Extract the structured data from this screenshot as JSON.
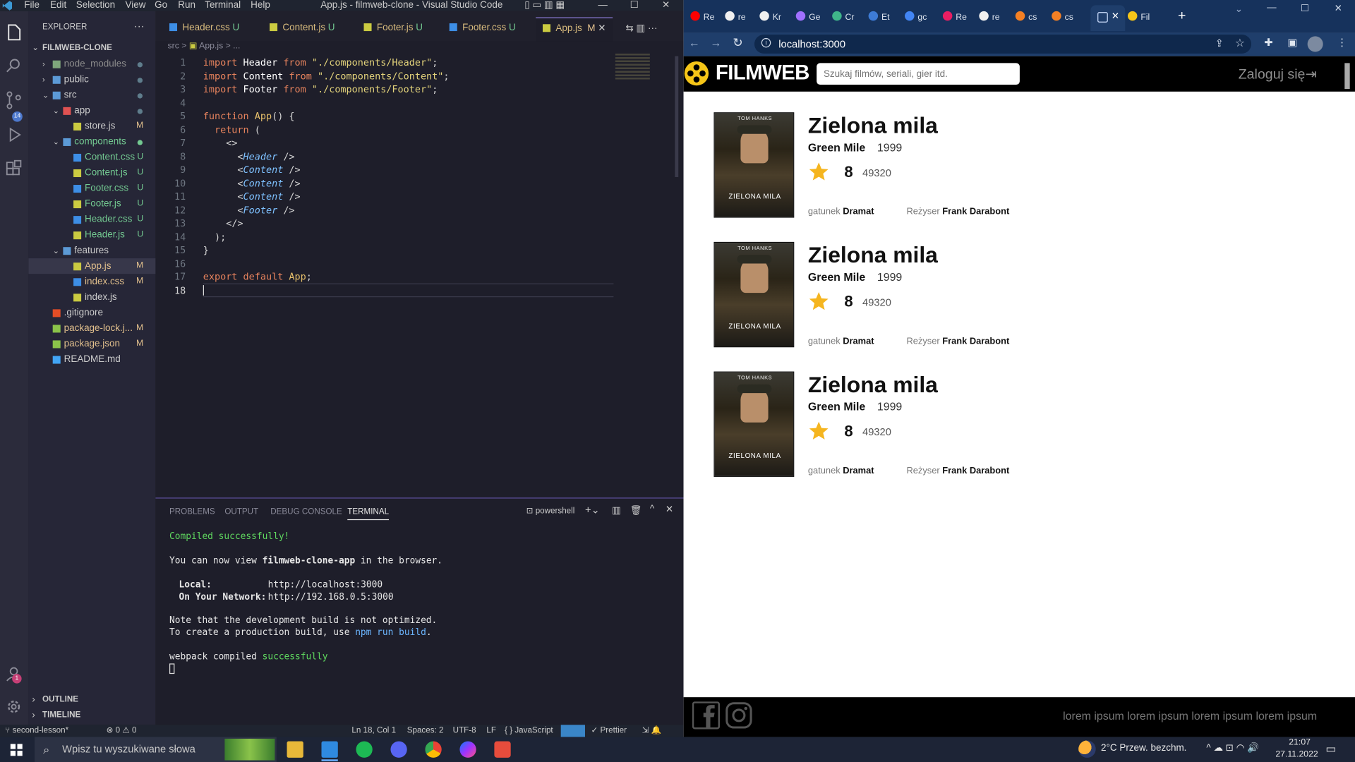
{
  "vscode": {
    "menu": [
      "File",
      "Edit",
      "Selection",
      "View",
      "Go",
      "Run",
      "Terminal",
      "Help"
    ],
    "title": "App.js - filmweb-clone - Visual Studio Code",
    "explorer_label": "EXPLORER",
    "project": "FILMWEB-CLONE",
    "scm_badge": "14",
    "accounts_badge": "1",
    "tree": [
      {
        "label": "node_modules",
        "color": "#8b8b8b",
        "status": "",
        "dot": true
      },
      {
        "label": "public",
        "color": "#cccccc",
        "status": "",
        "dot": true
      },
      {
        "label": "src",
        "color": "#cccccc",
        "status": "",
        "dot": true
      },
      {
        "label": "app",
        "color": "#cccccc",
        "status": "",
        "dot": true
      },
      {
        "label": "store.js",
        "color": "#cccccc",
        "status": "M"
      },
      {
        "label": "components",
        "color": "#73c991",
        "status": "",
        "dot": true
      },
      {
        "label": "Content.css",
        "color": "#73c991",
        "status": "U"
      },
      {
        "label": "Content.js",
        "color": "#73c991",
        "status": "U"
      },
      {
        "label": "Footer.css",
        "color": "#73c991",
        "status": "U"
      },
      {
        "label": "Footer.js",
        "color": "#73c991",
        "status": "U"
      },
      {
        "label": "Header.css",
        "color": "#73c991",
        "status": "U"
      },
      {
        "label": "Header.js",
        "color": "#73c991",
        "status": "U"
      },
      {
        "label": "features",
        "color": "#cccccc",
        "status": ""
      },
      {
        "label": "App.js",
        "color": "#e2c08d",
        "status": "M"
      },
      {
        "label": "index.css",
        "color": "#e2c08d",
        "status": "M"
      },
      {
        "label": "index.js",
        "color": "#cccccc",
        "status": ""
      },
      {
        "label": ".gitignore",
        "color": "#cccccc",
        "status": ""
      },
      {
        "label": "package-lock.j...",
        "color": "#e2c08d",
        "status": "M"
      },
      {
        "label": "package.json",
        "color": "#e2c08d",
        "status": "M"
      },
      {
        "label": "README.md",
        "color": "#cccccc",
        "status": ""
      }
    ],
    "outline": "OUTLINE",
    "timeline": "TIMELINE",
    "tabs": [
      {
        "name": "Header.css",
        "status": "U"
      },
      {
        "name": "Content.js",
        "status": "U"
      },
      {
        "name": "Footer.js",
        "status": "U"
      },
      {
        "name": "Footer.css",
        "status": "U"
      },
      {
        "name": "App.js",
        "status": "M"
      }
    ],
    "breadcrumb": [
      "src",
      ">",
      "App.js",
      ">",
      "..."
    ],
    "line_numbers": [
      "1",
      "2",
      "3",
      "4",
      "5",
      "6",
      "7",
      "8",
      "9",
      "10",
      "11",
      "12",
      "13",
      "14",
      "15",
      "16",
      "17",
      "18"
    ],
    "panel_tabs": [
      "PROBLEMS",
      "OUTPUT",
      "DEBUG CONSOLE",
      "TERMINAL"
    ],
    "shell": "powershell",
    "terminal": {
      "compiled": "Compiled successfully!",
      "view1": "You can now view ",
      "appname": "filmweb-clone-app",
      "view2": " in the browser.",
      "local_label": "Local:",
      "local_url": "http://localhost:3000",
      "net_label": "On Your Network:",
      "net_url": "http://192.168.0.5:3000",
      "note1": "Note that the development build is not optimized.",
      "note2a": "To create a production build, use ",
      "note2b": "npm run build",
      "note2c": ".",
      "webpack": "webpack compiled ",
      "success": "successfully"
    },
    "status": {
      "branch": "second-lesson*",
      "errors": "⊗ 0 ⚠ 0",
      "position": "Ln 18, Col 1",
      "spaces": "Spaces: 2",
      "encoding": "UTF-8",
      "eol": "LF",
      "language": "{ } JavaScript",
      "prettier": "✓ Prettier"
    }
  },
  "browser": {
    "tabs": [
      "Re",
      "re",
      "Kr",
      "Ge",
      "Cr",
      "Et",
      "gc",
      "Re",
      "re",
      "cs",
      "cs",
      "",
      "Fil"
    ],
    "url": "localhost:3000",
    "logo": "FILMWEB",
    "search_placeholder": "Szukaj filmów, seriali, gier itd.",
    "login": "Zaloguj się",
    "movies": [
      {
        "title": "Zielona mila",
        "original": "Green Mile",
        "year": "1999",
        "rating": "8",
        "votes": "49320",
        "genre_label": "gatunek",
        "genre": "Dramat",
        "director_label": "Reżyser",
        "director": "Frank Darabont",
        "poster_top": "TOM HANKS",
        "poster_bottom": "ZIELONA MILA"
      },
      {
        "title": "Zielona mila",
        "original": "Green Mile",
        "year": "1999",
        "rating": "8",
        "votes": "49320",
        "genre_label": "gatunek",
        "genre": "Dramat",
        "director_label": "Reżyser",
        "director": "Frank Darabont",
        "poster_top": "TOM HANKS",
        "poster_bottom": "ZIELONA MILA"
      },
      {
        "title": "Zielona mila",
        "original": "Green Mile",
        "year": "1999",
        "rating": "8",
        "votes": "49320",
        "genre_label": "gatunek",
        "genre": "Dramat",
        "director_label": "Reżyser",
        "director": "Frank Darabont",
        "poster_top": "TOM HANKS",
        "poster_bottom": "ZIELONA MILA"
      }
    ],
    "footer_text": "lorem ipsum lorem ipsum lorem ipsum lorem ipsum"
  },
  "taskbar": {
    "search_placeholder": "Wpisz tu wyszukiwane słowa",
    "weather": "2°C  Przew. bezchm.",
    "time": "21:07",
    "date": "27.11.2022"
  }
}
